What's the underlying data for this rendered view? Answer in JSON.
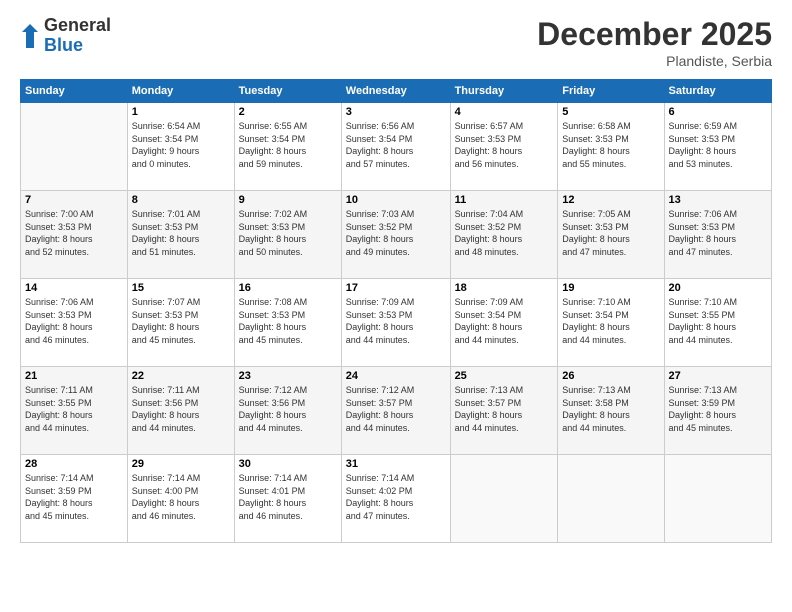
{
  "logo": {
    "general": "General",
    "blue": "Blue"
  },
  "header": {
    "month": "December 2025",
    "location": "Plandiste, Serbia"
  },
  "weekdays": [
    "Sunday",
    "Monday",
    "Tuesday",
    "Wednesday",
    "Thursday",
    "Friday",
    "Saturday"
  ],
  "weeks": [
    [
      {
        "day": "",
        "info": ""
      },
      {
        "day": "1",
        "info": "Sunrise: 6:54 AM\nSunset: 3:54 PM\nDaylight: 9 hours\nand 0 minutes."
      },
      {
        "day": "2",
        "info": "Sunrise: 6:55 AM\nSunset: 3:54 PM\nDaylight: 8 hours\nand 59 minutes."
      },
      {
        "day": "3",
        "info": "Sunrise: 6:56 AM\nSunset: 3:54 PM\nDaylight: 8 hours\nand 57 minutes."
      },
      {
        "day": "4",
        "info": "Sunrise: 6:57 AM\nSunset: 3:53 PM\nDaylight: 8 hours\nand 56 minutes."
      },
      {
        "day": "5",
        "info": "Sunrise: 6:58 AM\nSunset: 3:53 PM\nDaylight: 8 hours\nand 55 minutes."
      },
      {
        "day": "6",
        "info": "Sunrise: 6:59 AM\nSunset: 3:53 PM\nDaylight: 8 hours\nand 53 minutes."
      }
    ],
    [
      {
        "day": "7",
        "info": "Sunrise: 7:00 AM\nSunset: 3:53 PM\nDaylight: 8 hours\nand 52 minutes."
      },
      {
        "day": "8",
        "info": "Sunrise: 7:01 AM\nSunset: 3:53 PM\nDaylight: 8 hours\nand 51 minutes."
      },
      {
        "day": "9",
        "info": "Sunrise: 7:02 AM\nSunset: 3:53 PM\nDaylight: 8 hours\nand 50 minutes."
      },
      {
        "day": "10",
        "info": "Sunrise: 7:03 AM\nSunset: 3:52 PM\nDaylight: 8 hours\nand 49 minutes."
      },
      {
        "day": "11",
        "info": "Sunrise: 7:04 AM\nSunset: 3:52 PM\nDaylight: 8 hours\nand 48 minutes."
      },
      {
        "day": "12",
        "info": "Sunrise: 7:05 AM\nSunset: 3:53 PM\nDaylight: 8 hours\nand 47 minutes."
      },
      {
        "day": "13",
        "info": "Sunrise: 7:06 AM\nSunset: 3:53 PM\nDaylight: 8 hours\nand 47 minutes."
      }
    ],
    [
      {
        "day": "14",
        "info": "Sunrise: 7:06 AM\nSunset: 3:53 PM\nDaylight: 8 hours\nand 46 minutes."
      },
      {
        "day": "15",
        "info": "Sunrise: 7:07 AM\nSunset: 3:53 PM\nDaylight: 8 hours\nand 45 minutes."
      },
      {
        "day": "16",
        "info": "Sunrise: 7:08 AM\nSunset: 3:53 PM\nDaylight: 8 hours\nand 45 minutes."
      },
      {
        "day": "17",
        "info": "Sunrise: 7:09 AM\nSunset: 3:53 PM\nDaylight: 8 hours\nand 44 minutes."
      },
      {
        "day": "18",
        "info": "Sunrise: 7:09 AM\nSunset: 3:54 PM\nDaylight: 8 hours\nand 44 minutes."
      },
      {
        "day": "19",
        "info": "Sunrise: 7:10 AM\nSunset: 3:54 PM\nDaylight: 8 hours\nand 44 minutes."
      },
      {
        "day": "20",
        "info": "Sunrise: 7:10 AM\nSunset: 3:55 PM\nDaylight: 8 hours\nand 44 minutes."
      }
    ],
    [
      {
        "day": "21",
        "info": "Sunrise: 7:11 AM\nSunset: 3:55 PM\nDaylight: 8 hours\nand 44 minutes."
      },
      {
        "day": "22",
        "info": "Sunrise: 7:11 AM\nSunset: 3:56 PM\nDaylight: 8 hours\nand 44 minutes."
      },
      {
        "day": "23",
        "info": "Sunrise: 7:12 AM\nSunset: 3:56 PM\nDaylight: 8 hours\nand 44 minutes."
      },
      {
        "day": "24",
        "info": "Sunrise: 7:12 AM\nSunset: 3:57 PM\nDaylight: 8 hours\nand 44 minutes."
      },
      {
        "day": "25",
        "info": "Sunrise: 7:13 AM\nSunset: 3:57 PM\nDaylight: 8 hours\nand 44 minutes."
      },
      {
        "day": "26",
        "info": "Sunrise: 7:13 AM\nSunset: 3:58 PM\nDaylight: 8 hours\nand 44 minutes."
      },
      {
        "day": "27",
        "info": "Sunrise: 7:13 AM\nSunset: 3:59 PM\nDaylight: 8 hours\nand 45 minutes."
      }
    ],
    [
      {
        "day": "28",
        "info": "Sunrise: 7:14 AM\nSunset: 3:59 PM\nDaylight: 8 hours\nand 45 minutes."
      },
      {
        "day": "29",
        "info": "Sunrise: 7:14 AM\nSunset: 4:00 PM\nDaylight: 8 hours\nand 46 minutes."
      },
      {
        "day": "30",
        "info": "Sunrise: 7:14 AM\nSunset: 4:01 PM\nDaylight: 8 hours\nand 46 minutes."
      },
      {
        "day": "31",
        "info": "Sunrise: 7:14 AM\nSunset: 4:02 PM\nDaylight: 8 hours\nand 47 minutes."
      },
      {
        "day": "",
        "info": ""
      },
      {
        "day": "",
        "info": ""
      },
      {
        "day": "",
        "info": ""
      }
    ]
  ]
}
